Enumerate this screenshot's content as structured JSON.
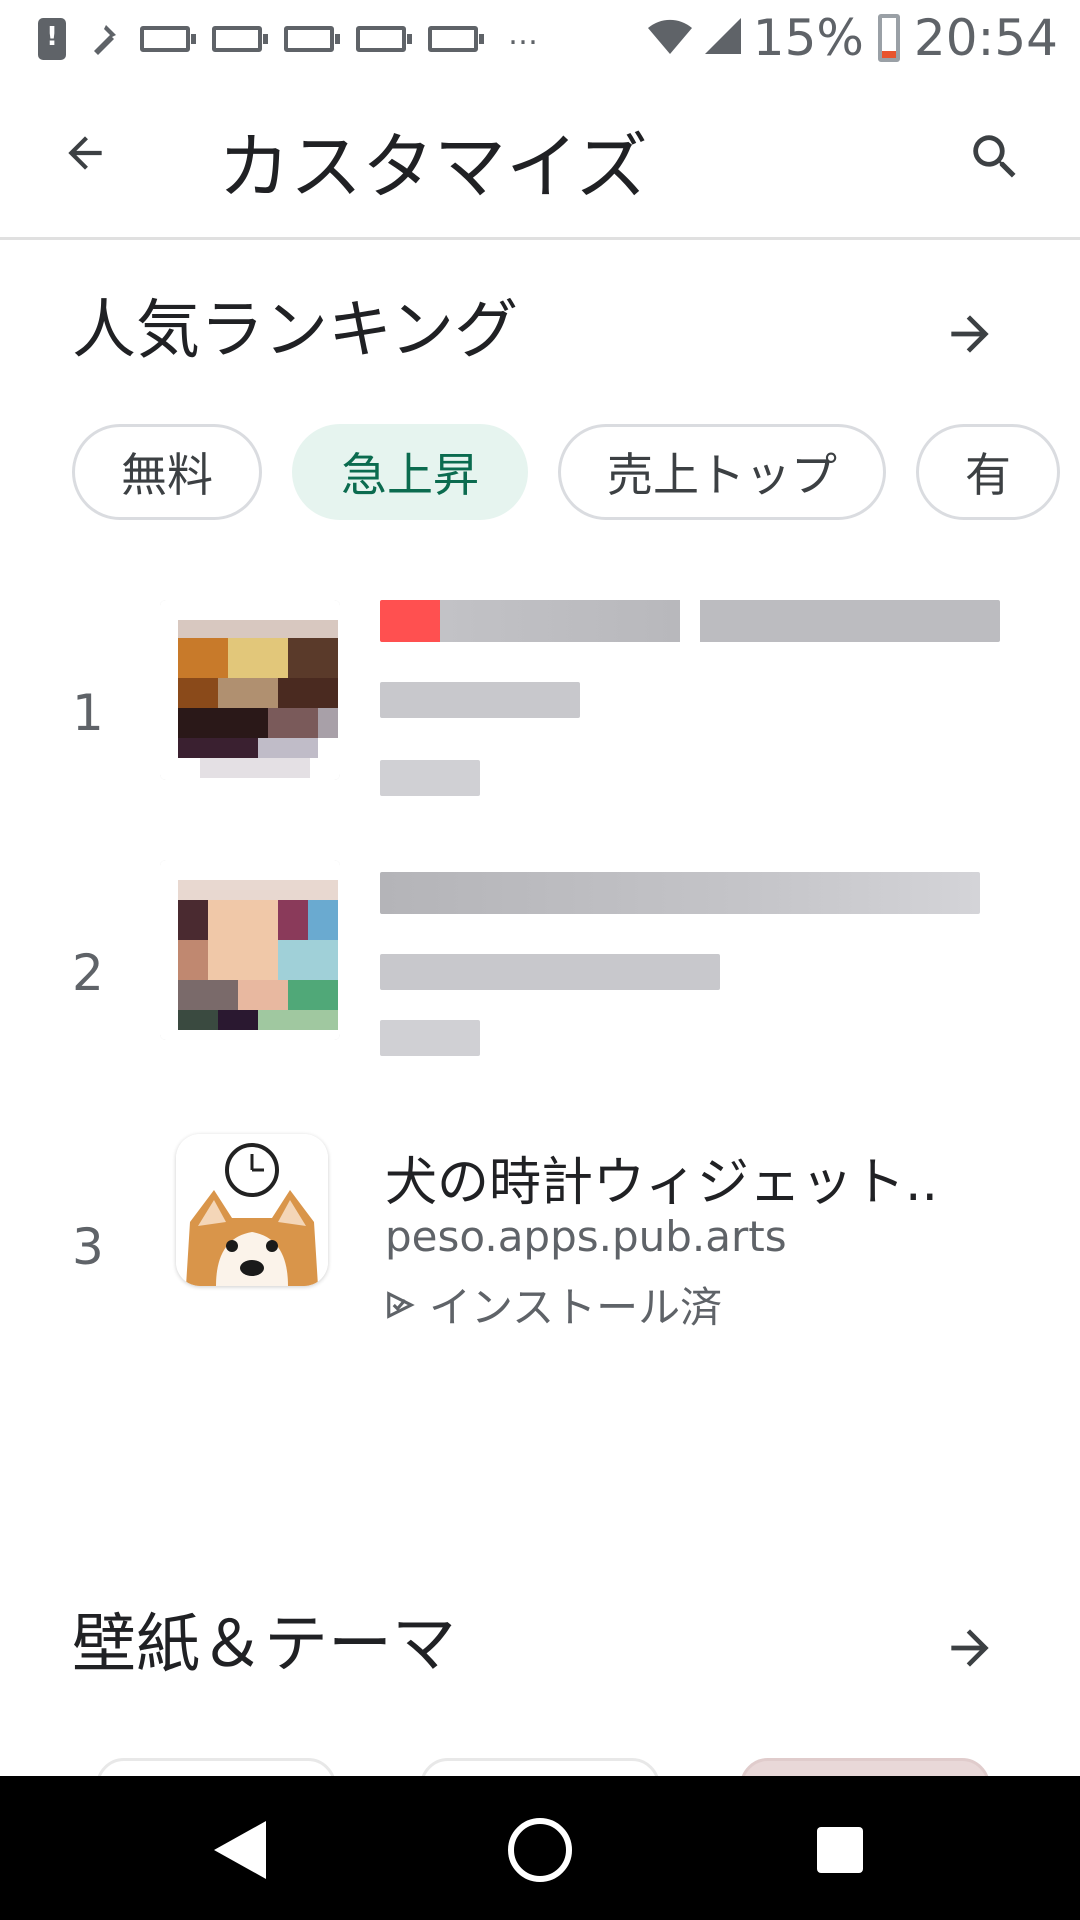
{
  "status_bar": {
    "battery_percent": "15%",
    "time": "20:54",
    "overflow": "…"
  },
  "app_bar": {
    "title": "カスタマイズ"
  },
  "ranking": {
    "title": "人気ランキング",
    "chips": [
      {
        "label": "無料",
        "selected": false
      },
      {
        "label": "急上昇",
        "selected": true
      },
      {
        "label": "売上トップ",
        "selected": false
      },
      {
        "label": "有",
        "selected": false
      }
    ],
    "items": [
      {
        "rank": "1"
      },
      {
        "rank": "2"
      },
      {
        "rank": "3",
        "name": "犬の時計ウィジェット..",
        "developer": "peso.apps.pub.arts",
        "status": "インストール済"
      }
    ]
  },
  "wallpaper_section": {
    "title": "壁紙＆テーマ"
  },
  "colors": {
    "accent_green": "#0b6b4f",
    "chip_selected_bg": "#e6f4ef",
    "battery_low": "#e8542e"
  }
}
